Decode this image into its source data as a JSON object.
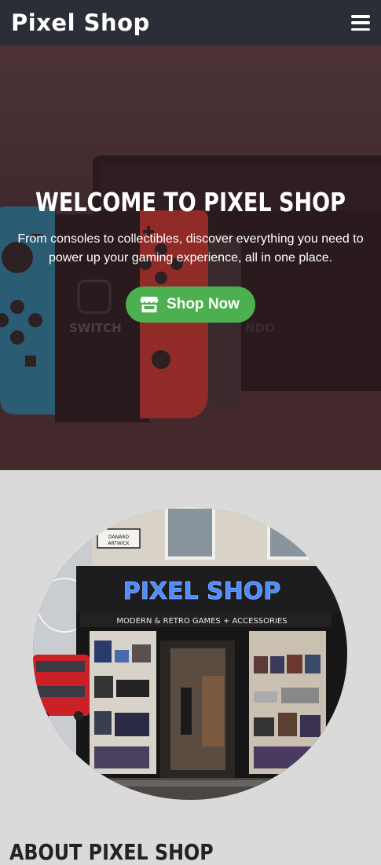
{
  "navbar": {
    "brand": "Pixel Shop",
    "menu_icon": "hamburger-menu-icon"
  },
  "hero": {
    "title": "WELCOME TO PIXEL SHOP",
    "subtitle": "From consoles to collectibles, discover everything you need to power up your gaming experience, all in one place.",
    "cta_label": "Shop Now",
    "cta_icon": "store-icon",
    "switch_left_text": "SWITCH",
    "switch_right_text": "NDO"
  },
  "about": {
    "storefront_sign": "PIXEL SHOP",
    "storefront_tagline": "MODERN & RETRO GAMES + ACCESSORIES",
    "street_sign": "DANARD ARTWICK",
    "heading": "ABOUT PIXEL SHOP"
  },
  "colors": {
    "navbar_bg": "#2b2e36",
    "accent_green": "#4caf50",
    "section_bg": "#dadada",
    "joycon_blue": "#1fa0c8",
    "joycon_red": "#e03a32",
    "neon_blue": "#3b7bff"
  }
}
